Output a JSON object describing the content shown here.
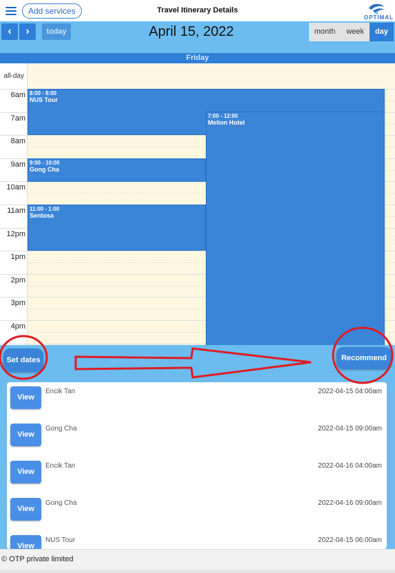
{
  "header": {
    "add_services_label": "Add services",
    "title": "Travel Itinerary Details",
    "logo_text": "OPTIMAL"
  },
  "toolbar": {
    "prev_icon": "chevron-left-icon",
    "next_icon": "chevron-right-icon",
    "prev_glyph": "‹",
    "next_glyph": "›",
    "today_label": "today",
    "date_title": "April 15, 2022",
    "views": [
      "month",
      "week",
      "day"
    ],
    "active_view": "day"
  },
  "calendar": {
    "day_header": "Friday",
    "allday_label": "all-day",
    "time_labels": [
      "6am",
      "7am",
      "8am",
      "9am",
      "10am",
      "11am",
      "12pm",
      "1pm",
      "2pm",
      "3pm",
      "4pm"
    ],
    "events": [
      {
        "time": "8:00 - 8:00",
        "title": "NUS Tour"
      },
      {
        "time": "7:00 - 12:00",
        "title": "Melion Hotel"
      },
      {
        "time": "9:00 - 10:00",
        "title": "Gong Cha"
      },
      {
        "time": "11:00 - 1:00",
        "title": "Sentosa"
      }
    ]
  },
  "actions": {
    "set_dates_label": "Set dates",
    "recommend_label": "Recommend"
  },
  "list": {
    "view_label": "View",
    "rows": [
      {
        "name": "Encik Tan",
        "datetime": "2022-04-15 04:00am"
      },
      {
        "name": "Gong Cha",
        "datetime": "2022-04-15 09:00am"
      },
      {
        "name": "Encik Tan",
        "datetime": "2022-04-16 04:00am"
      },
      {
        "name": "Gong Cha",
        "datetime": "2022-04-16 09:00am"
      },
      {
        "name": "NUS Tour",
        "datetime": "2022-04-15 06:00am"
      }
    ]
  },
  "footer": {
    "text": "© OTP private limited"
  },
  "colors": {
    "primary": "#2f7fd8",
    "toolbar_bg": "#6cbcef",
    "event_bg": "#3a85d8",
    "grid_bg": "#fff8e1",
    "annotation_red": "#e01b24"
  }
}
